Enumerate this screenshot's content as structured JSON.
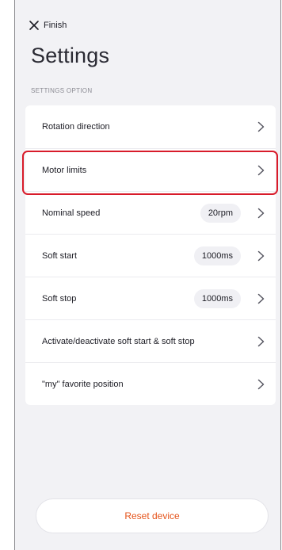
{
  "header": {
    "finish_label": "Finish",
    "title": "Settings",
    "section_label": "SETTINGS OPTION"
  },
  "settings": {
    "items": [
      {
        "label": "Rotation direction",
        "value": null
      },
      {
        "label": "Motor limits",
        "value": null,
        "highlighted": true
      },
      {
        "label": "Nominal speed",
        "value": "20rpm"
      },
      {
        "label": "Soft start",
        "value": "1000ms"
      },
      {
        "label": "Soft stop",
        "value": "1000ms"
      },
      {
        "label": "Activate/deactivate soft start & soft stop",
        "value": null
      },
      {
        "label": "\"my\" favorite position",
        "value": null
      }
    ]
  },
  "footer": {
    "reset_label": "Reset device"
  },
  "colors": {
    "accent_orange": "#e5531a",
    "highlight_red": "#d81b2a",
    "background": "#f2f2f5"
  },
  "icons": {
    "close": "close-icon",
    "chevron": "chevron-right-icon"
  }
}
